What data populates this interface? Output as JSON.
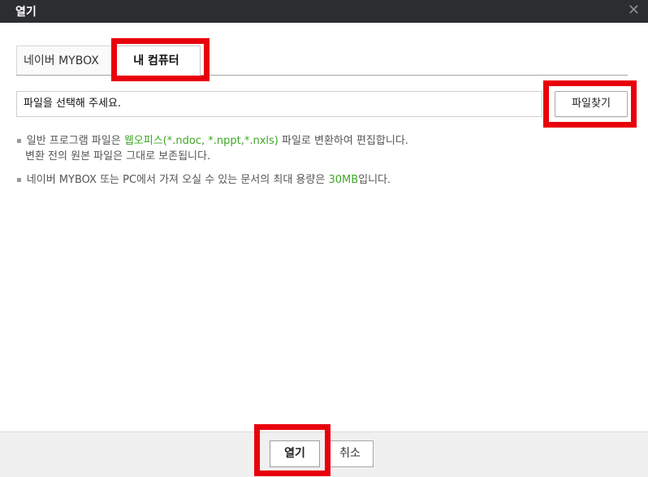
{
  "dialog": {
    "title": "열기",
    "close_icon": "close-icon",
    "close_glyph": "✕"
  },
  "tabs": [
    {
      "label": "네이버 MYBOX",
      "selected": false
    },
    {
      "label": "내 컴퓨터",
      "selected": true
    }
  ],
  "file": {
    "placeholder": "파일을 선택해 주세요.",
    "browse_label": "파일찾기"
  },
  "info": {
    "line1_a": "일반 프로그램 파일은 ",
    "line1_highlight": "웹오피스(*.ndoc, *.nppt,*.nxls)",
    "line1_b": " 파일로 변환하여 편집합니다.",
    "line1_cont": "변환 전의 원본 파일은 그대로 보존됩니다.",
    "line2_a": "네이버 MYBOX 또는 PC에서 가져 오실 수 있는 문서의 최대 용량은 ",
    "line2_highlight": "30MB",
    "line2_b": "입니다."
  },
  "footer": {
    "open_label": "열기",
    "cancel_label": "취소"
  },
  "colors": {
    "titlebar": "#2c2d30",
    "highlight_green": "#3fa628",
    "annotation_red": "#e8000b",
    "footer_bg": "#f0f0f0"
  }
}
